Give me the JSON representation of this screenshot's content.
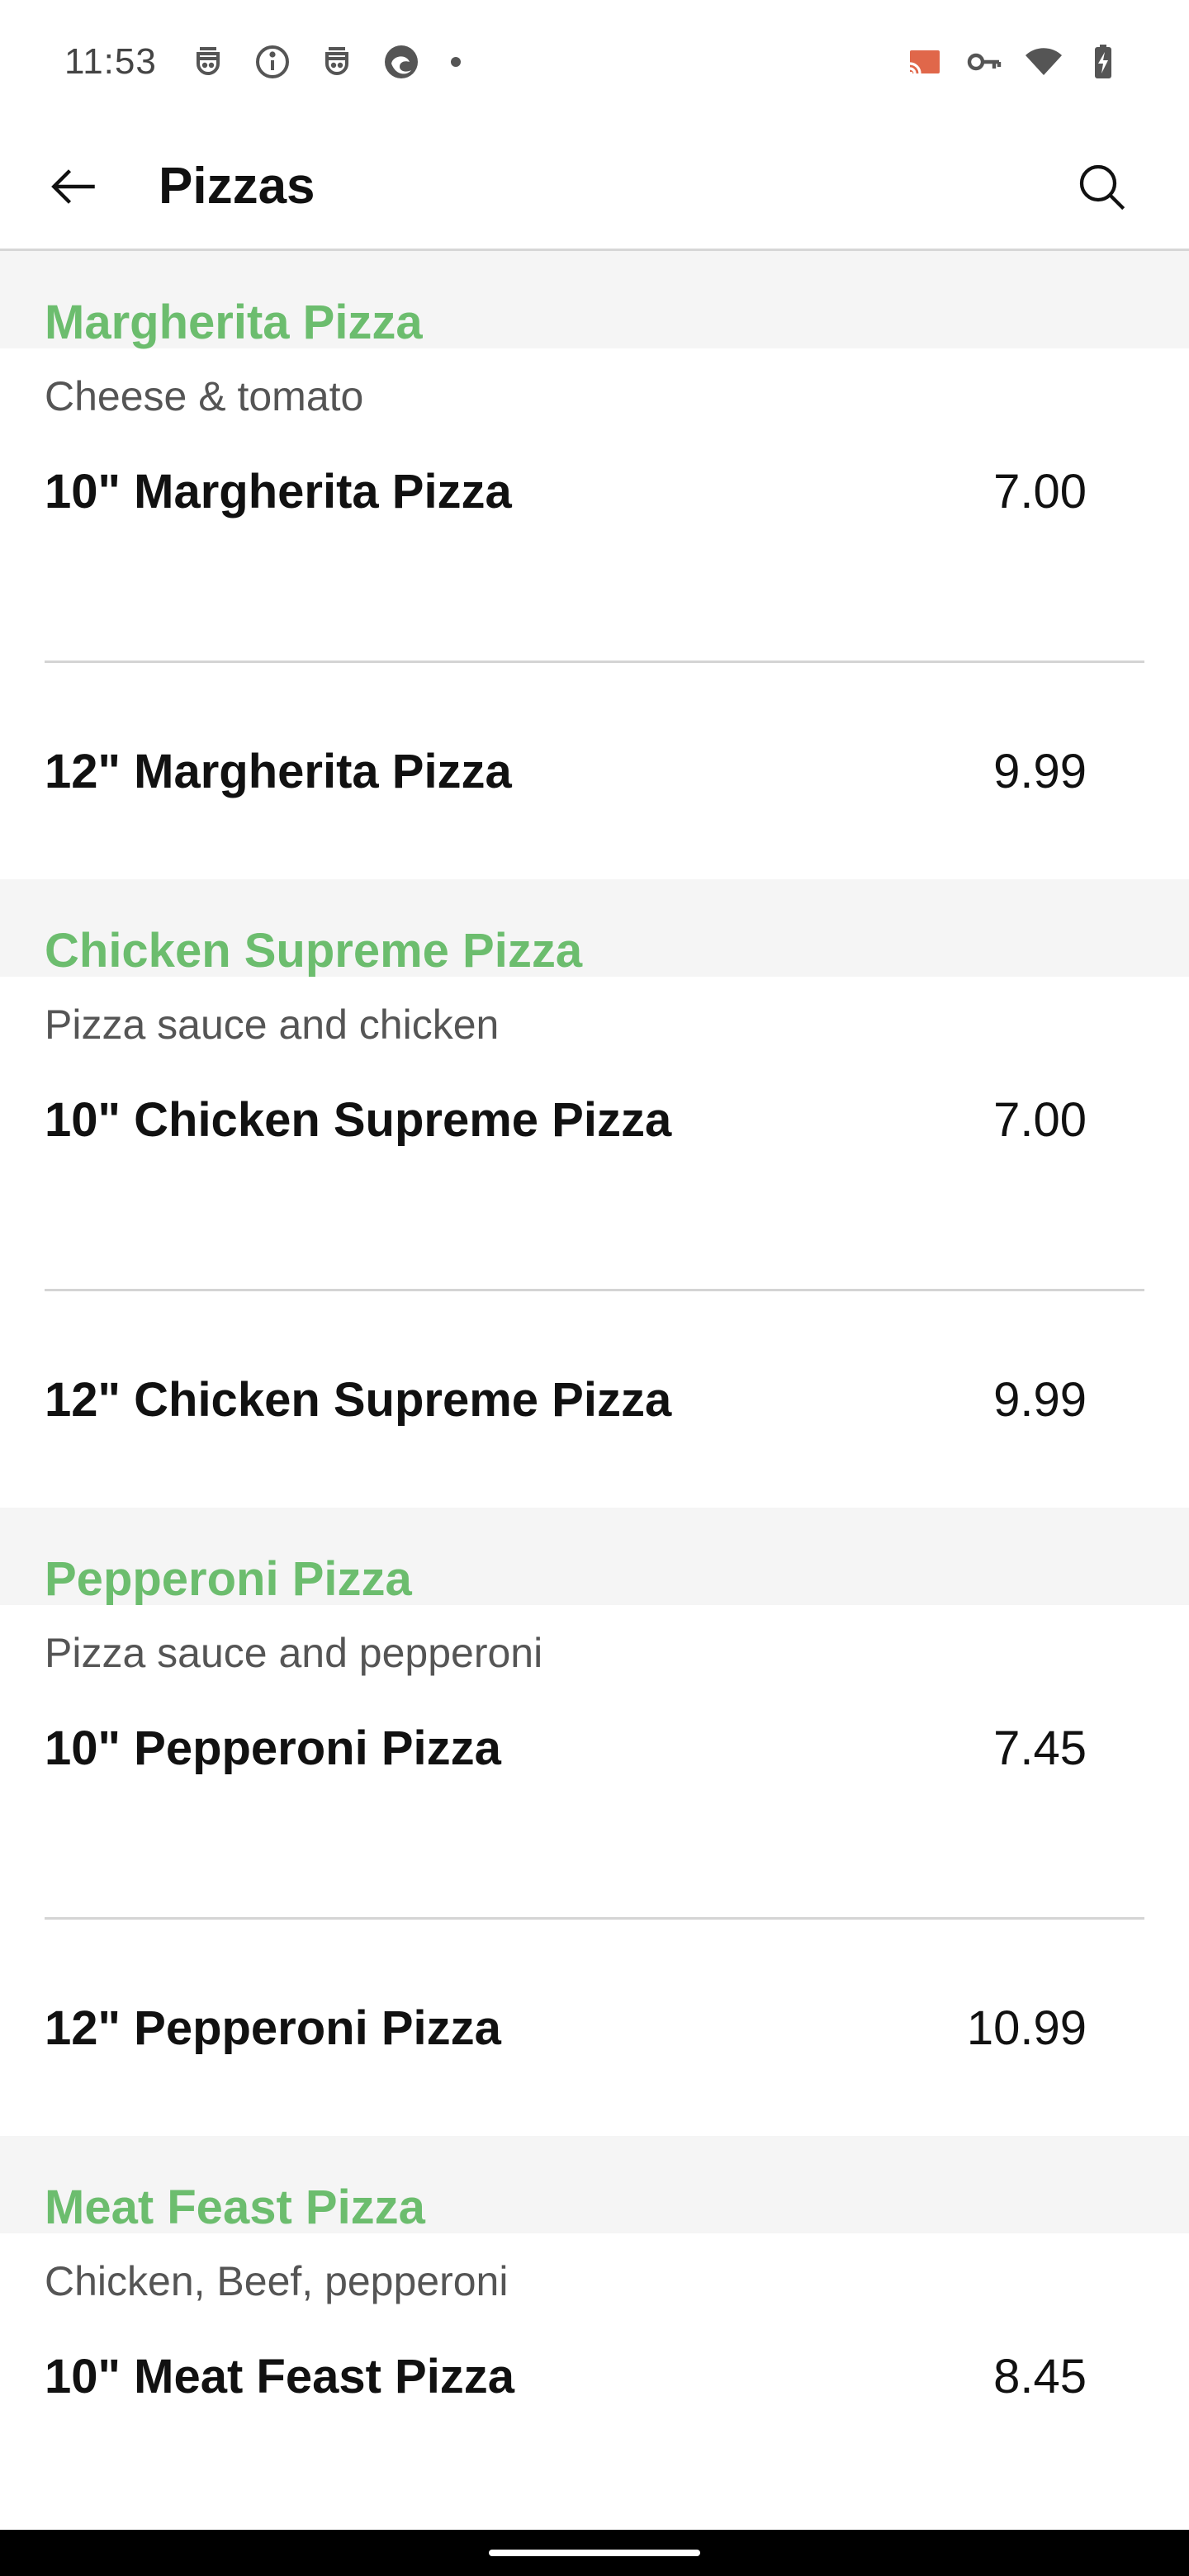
{
  "status_bar": {
    "time": "11:53",
    "left_icons": [
      "face-icon",
      "info-icon",
      "face-icon",
      "edge-browser-icon",
      "notification-dot"
    ],
    "right_icons": [
      "cast-icon",
      "vpn-key-icon",
      "wifi-icon",
      "battery-charging-icon"
    ]
  },
  "app_bar": {
    "title": "Pizzas",
    "back_icon": "arrow-left-icon",
    "search_icon": "search-icon"
  },
  "colors": {
    "section_title": "#6cbd6e",
    "section_header_bg": "#f5f5f5",
    "divider": "#d4d4d4"
  },
  "sections": [
    {
      "title": "Margherita Pizza",
      "description": "Cheese & tomato",
      "items": [
        {
          "name": "10\" Margherita Pizza",
          "price": "7.00"
        },
        {
          "name": "12\" Margherita Pizza",
          "price": "9.99"
        }
      ]
    },
    {
      "title": "Chicken Supreme Pizza",
      "description": "Pizza sauce and chicken",
      "items": [
        {
          "name": "10\" Chicken Supreme Pizza",
          "price": "7.00"
        },
        {
          "name": "12\" Chicken Supreme Pizza",
          "price": "9.99"
        }
      ]
    },
    {
      "title": "Pepperoni Pizza",
      "description": "Pizza sauce and pepperoni",
      "items": [
        {
          "name": "10\" Pepperoni Pizza",
          "price": "7.45"
        },
        {
          "name": "12\" Pepperoni Pizza",
          "price": "10.99"
        }
      ]
    },
    {
      "title": "Meat Feast Pizza",
      "description": "Chicken, Beef, pepperoni",
      "items": [
        {
          "name": "10\" Meat Feast Pizza",
          "price": "8.45"
        }
      ]
    }
  ]
}
